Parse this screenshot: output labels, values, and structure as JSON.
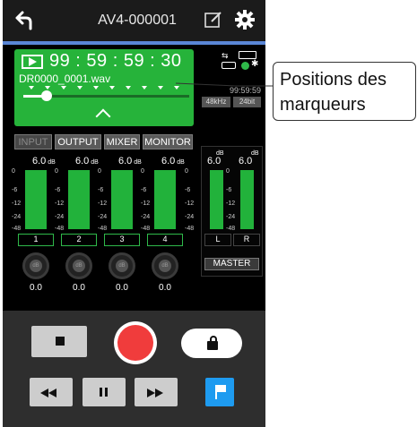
{
  "header": {
    "device_name": "AV4-000001"
  },
  "recorder": {
    "time": "99 : 59 : 59 : 30",
    "file_name": "DR0000_0001.wav",
    "position_fraction": 0.14,
    "remaining_time": "99:59:59",
    "sample_rate": "48kHz",
    "bit_depth": "24bit"
  },
  "callout": {
    "text": "Positions des marqueurs"
  },
  "tabs": [
    "INPUT",
    "OUTPUT",
    "MIXER",
    "MONITOR"
  ],
  "meters": {
    "scale": [
      "0",
      "-6",
      "-12",
      "-24",
      "-48"
    ],
    "db_unit": "dB",
    "channels": [
      {
        "label": "1",
        "value": "6.0",
        "knob": "0.0"
      },
      {
        "label": "2",
        "value": "6.0",
        "knob": "0.0"
      },
      {
        "label": "3",
        "value": "6.0",
        "knob": "0.0"
      },
      {
        "label": "4",
        "value": "6.0",
        "knob": "0.0"
      }
    ],
    "knob_unit": "dB",
    "master": {
      "left_value": "6.0",
      "right_value": "6.0",
      "left_label": "L",
      "right_label": "R",
      "button": "MASTER"
    }
  },
  "colors": {
    "accent_green": "#26b33a",
    "header_line": "#5a86d6",
    "rec_red": "#f03c3c",
    "mark_blue": "#1e9bf0"
  }
}
